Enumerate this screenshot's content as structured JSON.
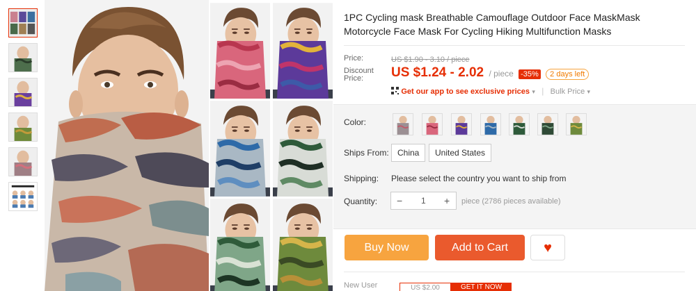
{
  "product": {
    "title": "1PC Cycling mask Breathable Camouflage Outdoor Face MaskMask Motorcycle Face Mask For Cycling Hiking Multifunction Masks"
  },
  "pricing": {
    "price_label": "Price:",
    "original_price": "US $1.90 - 3.10 / piece",
    "discount_label_line1": "Discount",
    "discount_label_line2": "Price:",
    "discount_price": "US $1.24 - 2.02",
    "per_unit": "/ piece",
    "discount_pct": "-35%",
    "days_left": "2 days left",
    "app_promo": "Get our app to see exclusive prices",
    "bulk_price": "Bulk Price"
  },
  "options": {
    "color_label": "Color:",
    "ships_from_label": "Ships From:",
    "ships_from": [
      "China",
      "United States"
    ],
    "shipping_label": "Shipping:",
    "shipping_text": "Please select the country you want to ship from",
    "quantity_label": "Quantity:",
    "quantity_value": "1",
    "minus": "−",
    "plus": "+",
    "availability": "piece (2786 pieces available)"
  },
  "actions": {
    "buy_now": "Buy Now",
    "add_to_cart": "Add to Cart",
    "wishlist_icon": "heart-icon"
  },
  "promo": {
    "new_user": "New User",
    "coupon_value": "US $2.00",
    "get_it_now": "GET IT NOW"
  },
  "colors": {
    "accent": "#e62e04",
    "buy_now": "#f7a43f",
    "add_to_cart": "#ea5a2d"
  },
  "swatches": [
    "gray-camo",
    "pink-camo",
    "purple-camo",
    "blue-camo",
    "green-camo",
    "dark-camo",
    "yellow-camo"
  ]
}
